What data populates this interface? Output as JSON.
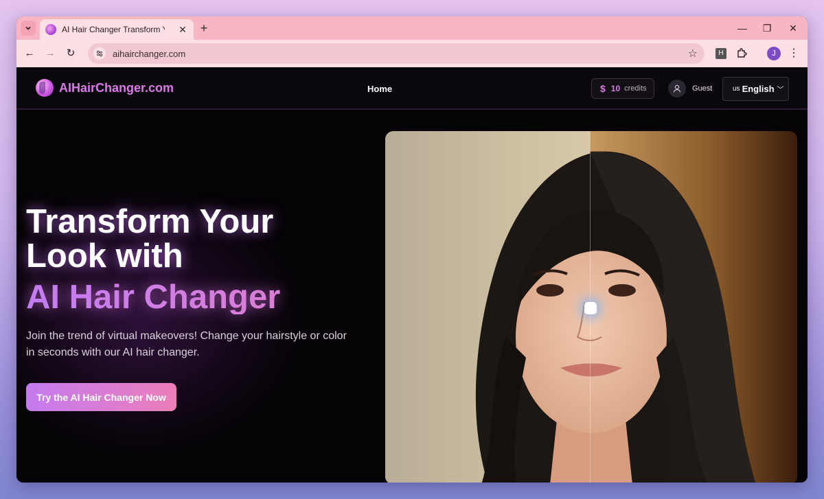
{
  "browser": {
    "tab_title": "AI Hair Changer Transform Your",
    "url": "aihairchanger.com",
    "profile_initial": "J",
    "extension_letter": "H"
  },
  "site": {
    "logo_text": "AIHairChanger.com",
    "nav_home": "Home",
    "credits_symbol": "$",
    "credits_count": "10",
    "credits_label": "credits",
    "guest_label": "Guest",
    "lang_flag": "us",
    "lang_label": "English"
  },
  "hero": {
    "title_line1": "Transform Your",
    "title_line2": "Look with",
    "title_accent": "AI Hair Changer",
    "subtitle": "Join the trend of virtual makeovers! Change your hairstyle or color in seconds with our AI hair changer.",
    "cta_label": "Try the AI Hair Changer Now"
  },
  "colors": {
    "accent_purple": "#c47bef",
    "accent_pink": "#ec7eb9",
    "tab_strip": "#f8b5c2"
  },
  "compare": {
    "split_fraction": 0.5
  }
}
